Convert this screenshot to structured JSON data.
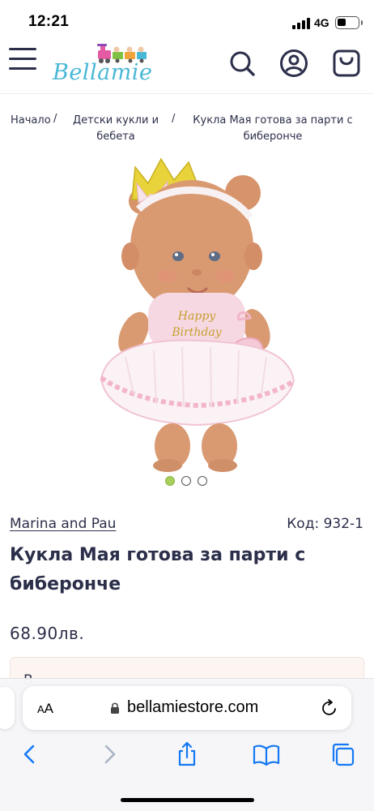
{
  "status_bar": {
    "time": "12:21",
    "network": "4G"
  },
  "header": {
    "logo_text": "Bellamie",
    "icons": [
      "hamburger-menu-icon",
      "search-icon",
      "account-icon",
      "cart-icon"
    ]
  },
  "breadcrumb": {
    "items": [
      {
        "label": "Начало",
        "line1": "Начало",
        "line2": ""
      },
      {
        "label": "Детски кукли и бебета",
        "line1": "Детски кукли и",
        "line2": "бебета"
      },
      {
        "label": "Кукла Мая готова за парти с биберонче",
        "line1": "Кукла Мая готова за парти с",
        "line2": "биберонче"
      }
    ],
    "separator": "/"
  },
  "product": {
    "image_caption_text": "Happy Birthday",
    "gallery": {
      "count": 3,
      "active_index": 0
    },
    "brand": "Marina and Pau",
    "code_label": "Код:",
    "code_value": "932-1",
    "code_full": "Код: 932-1",
    "title": "Кукла Мая готова за парти с биберонче",
    "price": "68.90лв.",
    "promo_text": "В"
  },
  "browser": {
    "text_size_label_small": "A",
    "text_size_label_large": "A",
    "url": "bellamiestore.com",
    "toolbar": [
      "back-icon",
      "forward-icon",
      "share-icon",
      "bookmarks-icon",
      "tabs-icon"
    ]
  },
  "colors": {
    "text_primary": "#2c2f4a",
    "logo_blue": "#49b7d6",
    "dot_active": "#a6cf5b",
    "safari_blue": "#1479f6",
    "promo_bg": "#fcf5f2"
  }
}
